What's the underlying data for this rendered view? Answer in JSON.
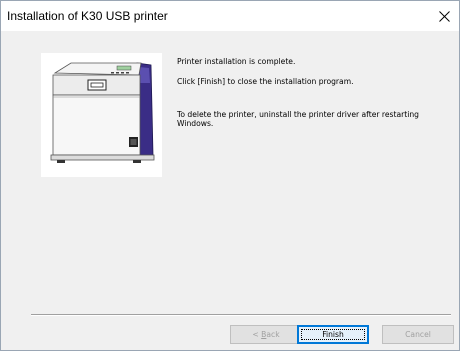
{
  "window": {
    "title": "Installation of K30 USB printer",
    "close_glyph": "X"
  },
  "illustration": {
    "icon": "card-printer-icon"
  },
  "messages": {
    "line1": "Printer installation is complete.",
    "line2": "Click [Finish] to close the installation program.",
    "line3": "To delete the printer, uninstall the printer driver after restarting Windows."
  },
  "buttons": {
    "back_prefix": "< ",
    "back_mnemonic": "B",
    "back_rest": "ack",
    "finish": "Finish",
    "cancel": "Cancel"
  },
  "colors": {
    "dialog_bg": "#f0f0f0",
    "title_bg": "#ffffff",
    "default_button_border": "#0078d7",
    "disabled_text": "#a0a0a0",
    "printer_accent": "#3a2d86"
  }
}
